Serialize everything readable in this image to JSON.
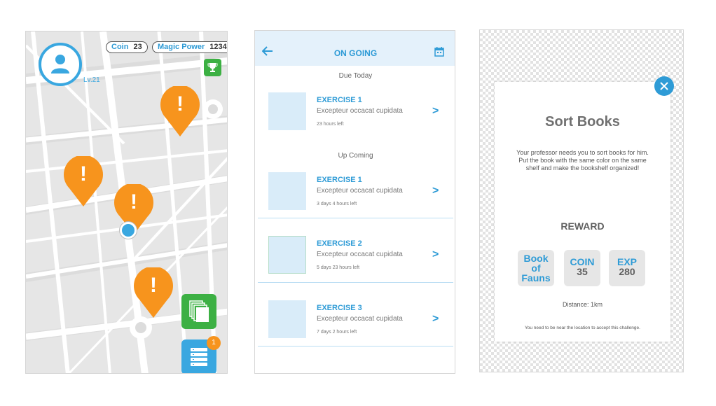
{
  "map": {
    "coin_label": "Coin",
    "coin_value": "23",
    "magic_label": "Magic Power",
    "magic_value": "1234",
    "level": "Lv.21",
    "marker_glyph": "!",
    "quest_list_badge": "1",
    "icons": [
      "user-icon",
      "trophy-icon",
      "cards-icon",
      "list-icon"
    ],
    "colors": {
      "accent": "#39a7e0",
      "marker": "#f7941d",
      "green": "#3cb043"
    }
  },
  "ongoing": {
    "title": "ON GOING",
    "due_today_label": "Due Today",
    "upcoming_label": "Up Coming",
    "arrow_glyph": ">",
    "due_today": [
      {
        "title": "EXERCISE 1",
        "desc": "Excepteur occacat cupidata",
        "time": "23 hours left"
      }
    ],
    "upcoming": [
      {
        "title": "EXERCISE 1",
        "desc": "Excepteur occacat cupidata",
        "time": "3 days 4 hours left"
      },
      {
        "title": "EXERCISE 2",
        "desc": "Excepteur occacat cupidata",
        "time": "5 days 23 hours left"
      },
      {
        "title": "EXERCISE 3",
        "desc": "Excepteur occacat cupidata",
        "time": "7 days 2 hours left"
      }
    ]
  },
  "challenge": {
    "title": "Sort Books",
    "description": "Your professor needs you to sort books for him. Put the book with the same color on the same shelf and make the bookshelf organized!",
    "reward_label": "REWARD",
    "rewards": {
      "book_line1": "Book",
      "book_line2": "of",
      "book_line3": "Fauns",
      "coin_label": "COIN",
      "coin_value": "35",
      "exp_label": "EXP",
      "exp_value": "280"
    },
    "distance": "Distance: 1km",
    "note": "You need to be near the location to accept this challenge."
  }
}
